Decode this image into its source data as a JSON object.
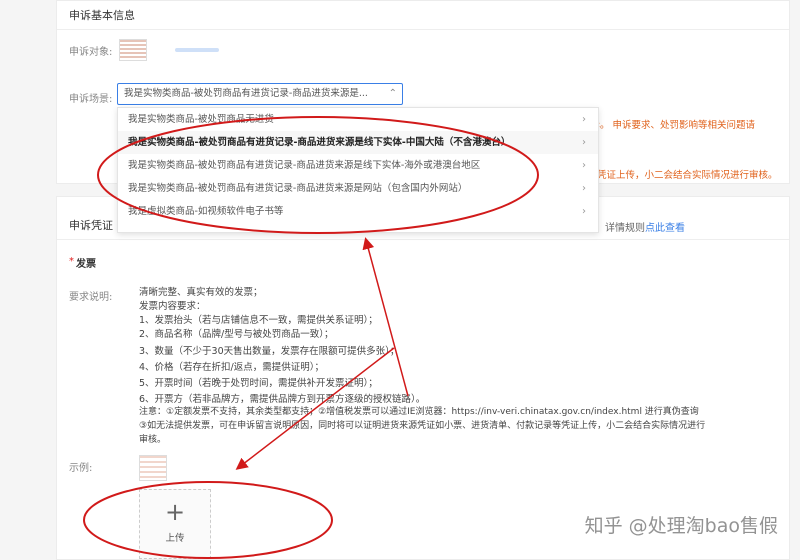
{
  "basic": {
    "title": "申诉基本信息",
    "object_label": "申诉对象:",
    "scene_label": "申诉场景:",
    "scene_value": "我是实物类商品-被处罚商品有进货记录-商品进货来源是...",
    "note_line1": "场景进行申诉。 申诉要求、处罚影响等相关问题请",
    "note_line2": "凭证上传，小二会结合实际情况进行审核。"
  },
  "dropdown": {
    "options": [
      {
        "label": "我是实物类商品-被处罚商品无进货",
        "has_submenu": true,
        "selected": false
      },
      {
        "label": "我是实物类商品-被处罚商品有进货记录-商品进货来源是线下实体-中国大陆（不含港澳台）",
        "has_submenu": true,
        "selected": true
      },
      {
        "label": "我是实物类商品-被处罚商品有进货记录-商品进货来源是线下实体-海外或港澳台地区",
        "has_submenu": true,
        "selected": false
      },
      {
        "label": "我是实物类商品-被处罚商品有进货记录-商品进货来源是网站（包含国内外网站）",
        "has_submenu": true,
        "selected": false
      },
      {
        "label": "我是虚拟类商品-如视频软件电子书等",
        "has_submenu": true,
        "selected": false
      }
    ]
  },
  "proof": {
    "title": "申诉凭证",
    "warning_text": "虚假凭证处罚。详情规则",
    "warning_link": "点此查看",
    "invoice_star": "*",
    "invoice_label": "发票",
    "req_label": "要求说明:",
    "req_lines": [
      "清晰完整、真实有效的发票；",
      "发票内容要求：",
      "1、发票抬头（若与店铺信息不一致，需提供关系证明）；",
      "2、商品名称（品牌/型号与被处罚商品一致）；",
      "3、数量（不少于30天售出数量，发票存在限额可提供多张）；",
      "4、价格（若存在折扣/返点，需提供证明）；",
      "5、开票时间（若晚于处罚时间，需提供补开发票证明）；",
      "6、开票方（若非品牌方，需提供品牌方到开票方逐级的授权链路）。",
      "注意：①定额发票不支持，其余类型都支持；②增值税发票可以通过IE浏览器：https://inv-veri.chinatax.gov.cn/index.html 进行真伪查询",
      "③如无法提供发票，可在申诉留言说明原因，同时将可以证明进货来源凭证如小票、进货清单、付款记录等凭证上传，小二会结合实际情况进行",
      "审核。"
    ],
    "sample_label": "示例:",
    "upload_label": "上传"
  },
  "watermark": "知乎 @处理淘bao售假",
  "colors": {
    "annotation": "#d11a1a",
    "accent": "#3a7fe6",
    "warning": "#e0621c"
  }
}
